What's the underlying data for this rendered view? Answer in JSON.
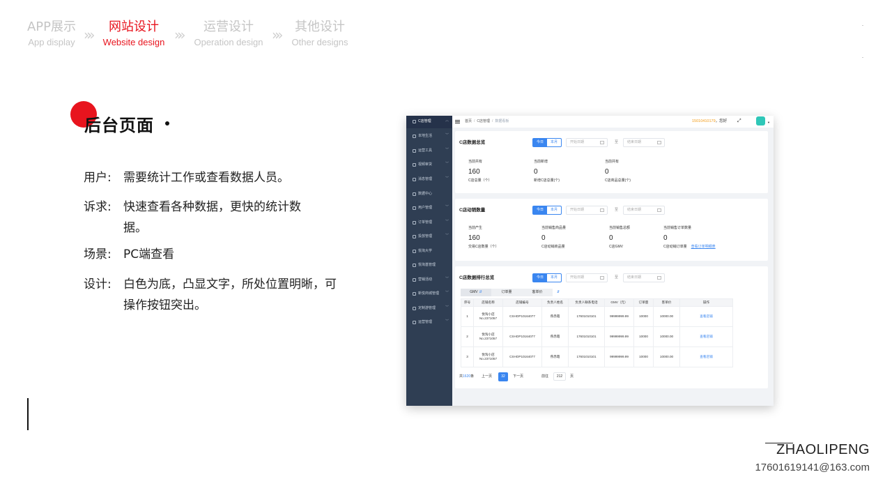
{
  "nav": {
    "items": [
      {
        "zh": "APP展示",
        "en": "App display"
      },
      {
        "zh": "网站设计",
        "en": "Website design"
      },
      {
        "zh": "运营设计",
        "en": "Operation design"
      },
      {
        "zh": "其他设计",
        "en": "Other designs"
      }
    ],
    "separator": "»",
    "active_index": 1
  },
  "section": {
    "title": "后台页面",
    "lines": [
      {
        "key": "用户:",
        "value": "需要统计工作或查看数据人员。"
      },
      {
        "key": "诉求:",
        "value": "快速查看各种数据，更快的统计数据。"
      },
      {
        "key": "场景:",
        "value": "PC端查看"
      },
      {
        "key": "设计:",
        "value": "白色为底，凸显文字，所处位置明晰，可操作按钮突出。"
      }
    ]
  },
  "footer": {
    "author": "ZHAOLIPENG",
    "email": "17601619141@163.com"
  },
  "colors": {
    "accent": "#e8141e",
    "admin_blue": "#3a86f0",
    "sidebar": "#2f3e53"
  },
  "admin": {
    "sidebar": [
      {
        "label": "C店管理",
        "icon": "store-icon"
      },
      {
        "label": "本地生活",
        "icon": "life-icon"
      },
      {
        "label": "运营工具",
        "icon": "tool-icon"
      },
      {
        "label": "视频审货",
        "icon": "video-icon"
      },
      {
        "label": "消息管理",
        "icon": "message-icon"
      },
      {
        "label": "数据中心",
        "icon": "data-icon"
      },
      {
        "label": "用户管理",
        "icon": "user-icon"
      },
      {
        "label": "订单管理",
        "icon": "order-icon"
      },
      {
        "label": "投放管理",
        "icon": "send-icon"
      },
      {
        "label": "悦淘大学",
        "icon": "school-icon"
      },
      {
        "label": "悦淘基管理",
        "icon": "mail-icon"
      },
      {
        "label": "营销活动",
        "icon": "marketing-icon"
      },
      {
        "label": "新悦商城管理",
        "icon": "mall-icon"
      },
      {
        "label": "定制游管理",
        "icon": "travel-icon"
      },
      {
        "label": "运营管理",
        "icon": "operation-icon"
      }
    ],
    "breadcrumb": [
      "首页",
      "C店管理",
      "数据看板"
    ],
    "greeting": {
      "phone": "15010410179",
      "text": "，您好"
    },
    "seg": {
      "today": "今日",
      "month": "本月"
    },
    "date": {
      "start": "开始日期",
      "to": "至",
      "end": "结束日期"
    },
    "cards": [
      {
        "title": "C店数据总览",
        "stats": [
          {
            "label": "当前共有",
            "value": "160",
            "sub": "C店总量（个）"
          },
          {
            "label": "当前新增",
            "value": "0",
            "sub": "新增C店总量(个)"
          },
          {
            "label": "当前共有",
            "value": "0",
            "sub": "C店商品总量(个)"
          }
        ]
      },
      {
        "title": "C店动销数量",
        "stats": [
          {
            "label": "当前产生",
            "value": "160",
            "sub": "交易C店数量（个）"
          },
          {
            "label": "当前销售商品量",
            "value": "0",
            "sub": "C店动销商品量"
          },
          {
            "label": "当前销售总额",
            "value": "0",
            "sub": "C店GMV"
          },
          {
            "label": "当前销售订单数量",
            "value": "0",
            "sub": "C店动销订单量",
            "link": "查看订单明细表"
          }
        ]
      },
      {
        "title": "C店数据排行总览",
        "tabs": [
          "GMV",
          "订单量",
          "客单价"
        ],
        "columns": [
          "序号",
          "店铺名称",
          "店铺编号",
          "负责人姓名",
          "负责人联系电话",
          "GMV（元）",
          "订单量",
          "客单价",
          "操作"
        ],
        "rows": [
          [
            "1",
            "悦淘小店\nNo.2371057",
            "CSHOP10164077",
            "燕赤霞",
            "17601010101",
            "99999999.99",
            "10000",
            "10000.00",
            "查看店铺"
          ],
          [
            "2",
            "悦淘小店\nNo.2371057",
            "CSHOP10164077",
            "燕赤霞",
            "17601010101",
            "99999999.99",
            "10000",
            "10000.00",
            "查看店铺"
          ],
          [
            "3",
            "悦淘小店\nNo.2371057",
            "CSHOP10164077",
            "燕赤霞",
            "17601010101",
            "99999999.99",
            "10000",
            "10000.00",
            "查看店铺"
          ]
        ],
        "pager": {
          "total_prefix": "共",
          "total": "1620",
          "total_suffix": "条",
          "prev": "上一页",
          "current": "32",
          "next": "下一页",
          "goto": "前往",
          "goto_value": "212",
          "page_suffix": "页"
        }
      }
    ]
  }
}
